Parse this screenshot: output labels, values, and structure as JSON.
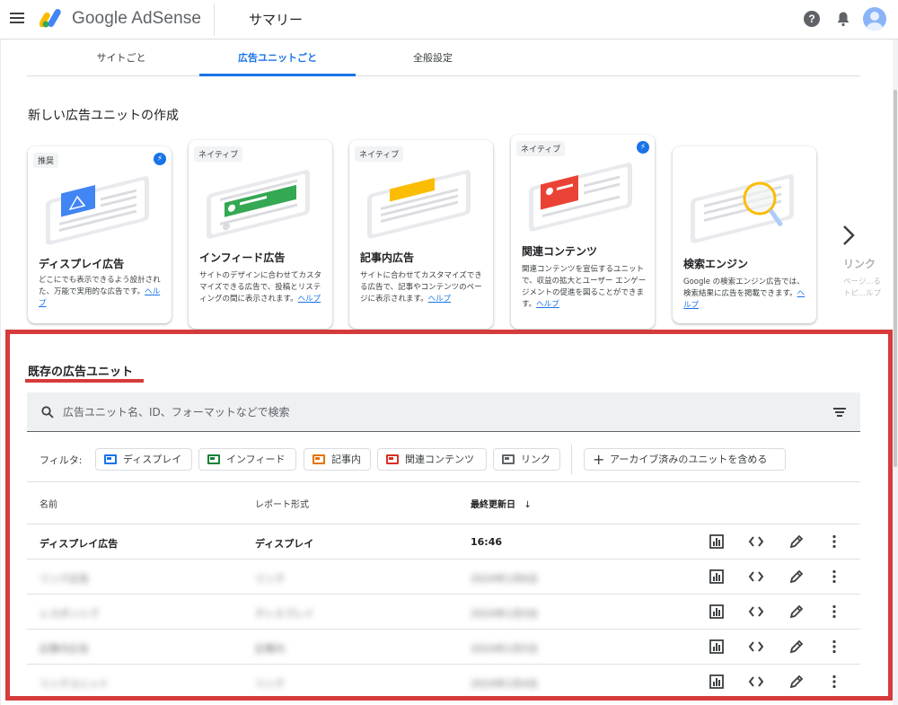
{
  "header": {
    "app_name": "Google AdSense",
    "page_title": "サマリー",
    "help_glyph": "?"
  },
  "tabs": [
    {
      "label": "サイトごと",
      "active": false
    },
    {
      "label": "広告ユニットごと",
      "active": true
    },
    {
      "label": "全般設定",
      "active": false
    }
  ],
  "create_section": {
    "title": "新しい広告ユニットの作成",
    "cards": [
      {
        "badge": "推奨",
        "title": "ディスプレイ広告",
        "desc": "どこにでも表示できるよう設計された、万能で実用的な広告です。",
        "help": "ヘルプ",
        "accent": "#4285f4",
        "bolt": true
      },
      {
        "badge": "ネイティブ",
        "title": "インフィード広告",
        "desc": "サイトのデザインに合わせてカスタマイズできる広告で、投稿とリスティングの間に表示されます。",
        "help": "ヘルプ",
        "accent": "#34a853",
        "bolt": false
      },
      {
        "badge": "ネイティブ",
        "title": "記事内広告",
        "desc": "サイトに合わせてカスタマイズできる広告で、記事やコンテンツのページに表示されます。",
        "help": "ヘルプ",
        "accent": "#fbbc04",
        "bolt": false
      },
      {
        "badge": "ネイティブ",
        "title": "関連コンテンツ",
        "desc": "関連コンテンツを宣伝するユニットで、収益の拡大とユーザー エンゲージメントの促進を図ることができます。",
        "help": "ヘルプ",
        "accent": "#ea4335",
        "bolt": true
      },
      {
        "badge": "",
        "title": "検索エンジン",
        "desc": "Google の検索エンジン広告では、検索結果に広告を掲載できます。",
        "help": "ヘルプ",
        "accent": "#fbbc04",
        "bolt": false
      },
      {
        "title": "リンク",
        "desc": "ページ...るトピ...ルプ"
      }
    ]
  },
  "existing": {
    "title": "既存の広告ユニット",
    "search_placeholder": "広告ユニット名、ID、フォーマットなどで検索",
    "filter_label": "フィルタ:",
    "chips": [
      {
        "label": "ディスプレイ",
        "color": "#1a73e8"
      },
      {
        "label": "インフィード",
        "color": "#188038"
      },
      {
        "label": "記事内",
        "color": "#e37400"
      },
      {
        "label": "関連コンテンツ",
        "color": "#d93025"
      },
      {
        "label": "リンク",
        "color": "#5f6368"
      }
    ],
    "archive_label": "アーカイブ済みのユニットを含める",
    "columns": {
      "name": "名前",
      "report_type": "レポート形式",
      "last_updated": "最終更新日",
      "sort_arrow": "↓"
    },
    "rows": [
      {
        "name": "ディスプレイ広告",
        "type": "ディスプレイ",
        "updated": "16:46",
        "blurred": false
      },
      {
        "name": "リンク広告",
        "type": "リンク",
        "updated": "2024年1月6日",
        "blurred": true
      },
      {
        "name": "レスポンシブ",
        "type": "ディスプレイ",
        "updated": "2024年1月5日",
        "blurred": true
      },
      {
        "name": "記事内広告",
        "type": "記事内",
        "updated": "2024年1月5日",
        "blurred": true
      },
      {
        "name": "リンクユニット",
        "type": "リンク",
        "updated": "2024年1月4日",
        "blurred": true
      }
    ]
  },
  "colors": {
    "accent": "#1a73e8",
    "highlight": "#d63b3b"
  }
}
